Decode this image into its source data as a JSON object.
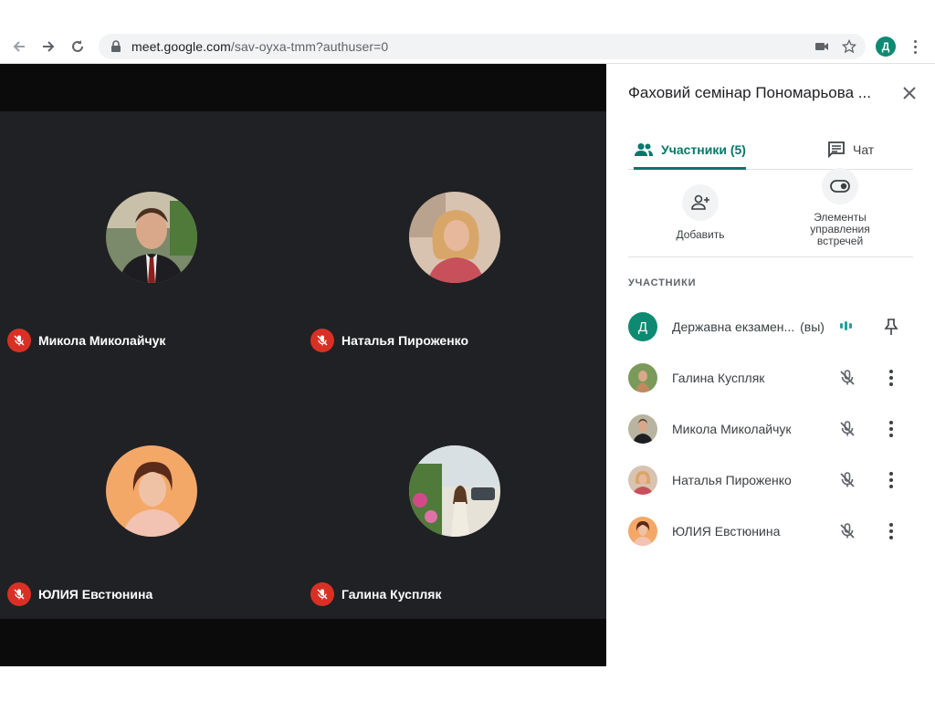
{
  "browser": {
    "url_host": "meet.google.com",
    "url_path": "/sav-oyxa-tmm?authuser=0",
    "profile_initial": "Д"
  },
  "tiles": [
    {
      "name": "Микола Миколайчук"
    },
    {
      "name": "Наталья Пироженко"
    },
    {
      "name": "ЮЛИЯ Евстюнина"
    },
    {
      "name": "Галина Куспляк"
    }
  ],
  "panel": {
    "title": "Фаховий семінар Пономарьова ...",
    "tabs": {
      "people": "Участники (5)",
      "chat": "Чат"
    },
    "actions": {
      "add": "Добавить",
      "controls": "Элементы управления встречей"
    },
    "section_heading": "УЧАСТНИКИ",
    "participants": [
      {
        "name": "Державна екзамен...",
        "you_label": "(вы)",
        "initial": "Д"
      },
      {
        "name": "Галина Куспляк"
      },
      {
        "name": "Микола Миколайчук"
      },
      {
        "name": "Наталья Пироженко"
      },
      {
        "name": "ЮЛИЯ Евстюнина"
      }
    ]
  },
  "colors": {
    "accent": "#00796b",
    "mic_off": "#d93025",
    "avatar_letter_bg": "#0f8a72"
  }
}
